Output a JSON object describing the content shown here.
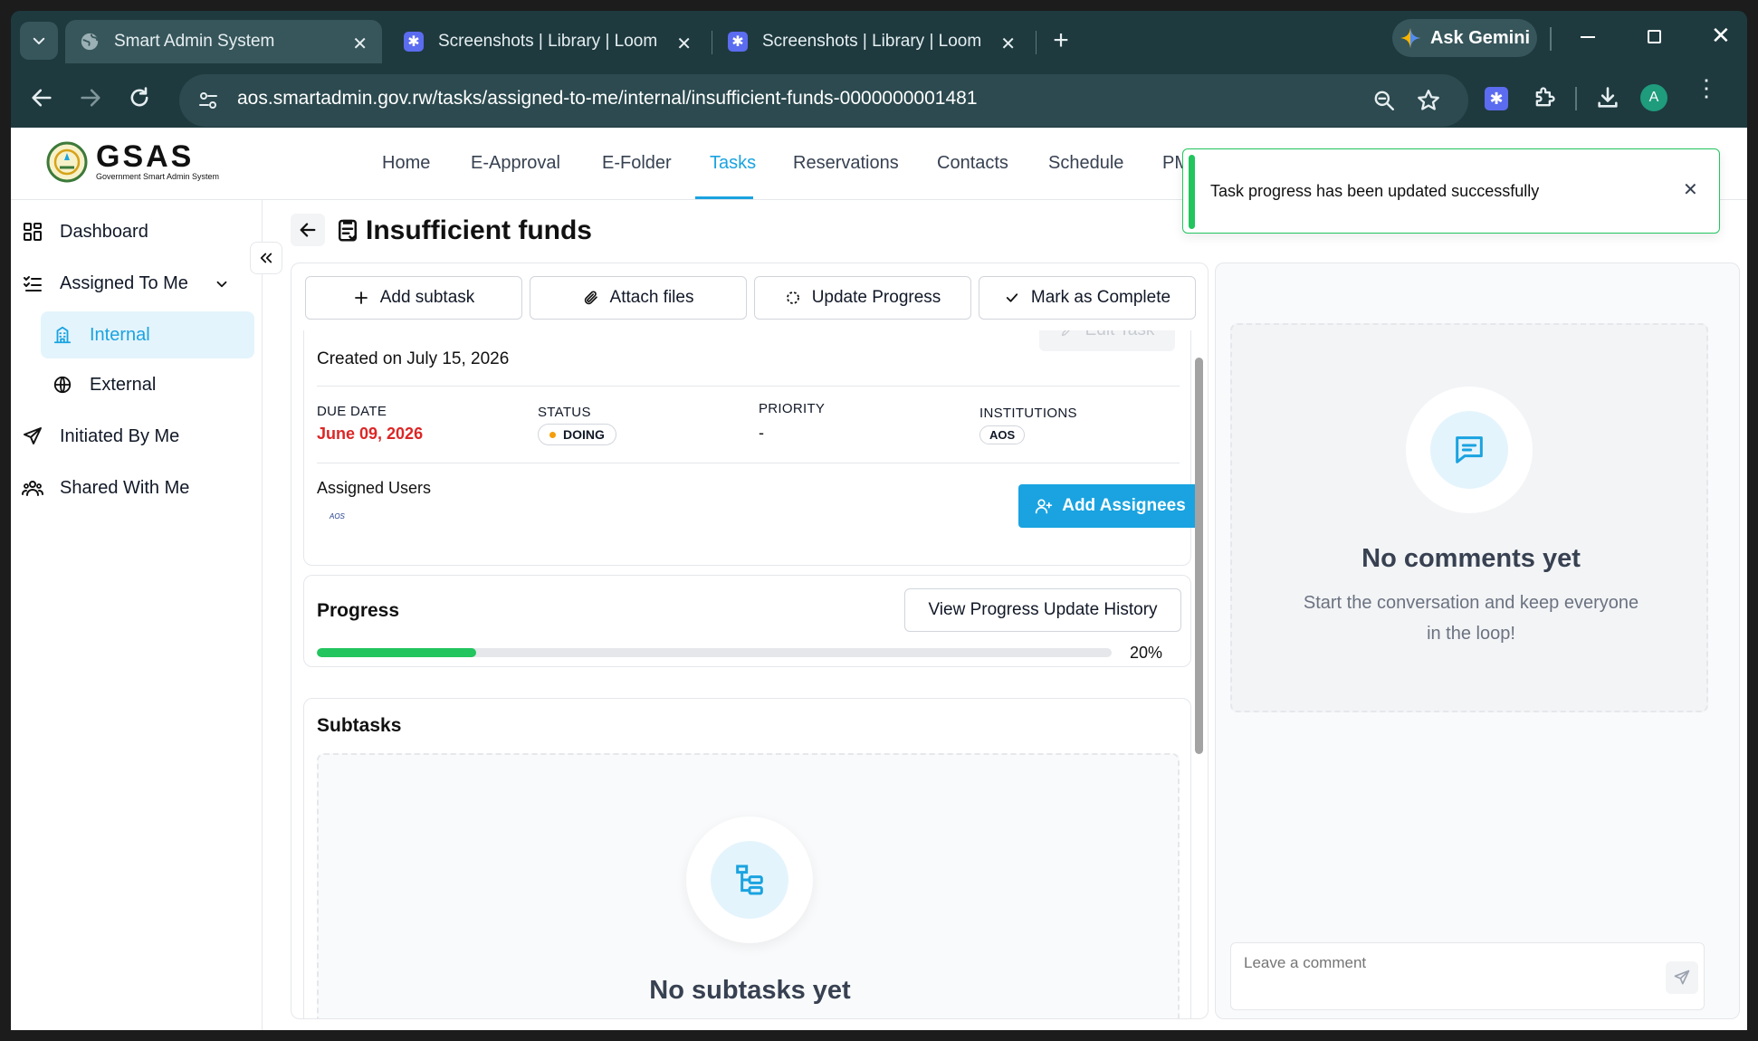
{
  "browser": {
    "tabs": [
      {
        "title": "Smart Admin System",
        "active": true
      },
      {
        "title": "Screenshots | Library | Loom",
        "active": false
      },
      {
        "title": "Screenshots | Library | Loom",
        "active": false
      }
    ],
    "new_tab_symbol": "+",
    "ask_gemini": "Ask Gemini",
    "url": "aos.smartadmin.gov.rw/tasks/assigned-to-me/internal/insufficient-funds-0000000001481",
    "profile_initial": "A"
  },
  "app": {
    "logo_text": "GSAS",
    "logo_subtitle": "Government Smart Admin System",
    "nav": [
      "Home",
      "E-Approval",
      "E-Folder",
      "Tasks",
      "Reservations",
      "Contacts",
      "Schedule",
      "PM"
    ],
    "active_nav": "Tasks"
  },
  "sidebar": {
    "items": [
      {
        "label": "Dashboard",
        "icon": "grid-icon"
      },
      {
        "label": "Assigned To Me",
        "icon": "list-check-icon"
      },
      {
        "label": "Internal",
        "icon": "building-icon"
      },
      {
        "label": "External",
        "icon": "globe-icon"
      },
      {
        "label": "Initiated By Me",
        "icon": "send-icon"
      },
      {
        "label": "Shared With Me",
        "icon": "users-icon"
      }
    ]
  },
  "page": {
    "title": "Insufficient funds",
    "actions": {
      "add_subtask": "Add subtask",
      "attach_files": "Attach files",
      "update_progress": "Update Progress",
      "mark_complete": "Mark as Complete"
    },
    "details": {
      "created": "Created on July 15, 2026",
      "edit_task": "Edit Task",
      "due_date_label": "DUE DATE",
      "due_date": "June 09, 2026",
      "status_label": "STATUS",
      "status": "DOING",
      "priority_label": "PRIORITY",
      "priority": "-",
      "institutions_label": "INSTITUTIONS",
      "institution": "AOS",
      "assigned_users_label": "Assigned Users",
      "assignee_logo_text": "AOS",
      "add_assignees": "Add Assignees"
    },
    "progress": {
      "title": "Progress",
      "history_button": "View Progress Update History",
      "percent_text": "20%",
      "value": 0.2
    },
    "subtasks": {
      "title": "Subtasks",
      "empty_title": "No subtasks yet"
    }
  },
  "comments": {
    "empty_title": "No comments yet",
    "empty_line1": "Start the conversation and keep everyone",
    "empty_line2": "in the loop!",
    "placeholder": "Leave a comment"
  },
  "toast": {
    "message": "Task progress has been updated successfully"
  },
  "colors": {
    "accent": "#1aa3e0",
    "success": "#22c55e",
    "due_date": "#dc2626",
    "status_dot": "#f59e0b"
  }
}
